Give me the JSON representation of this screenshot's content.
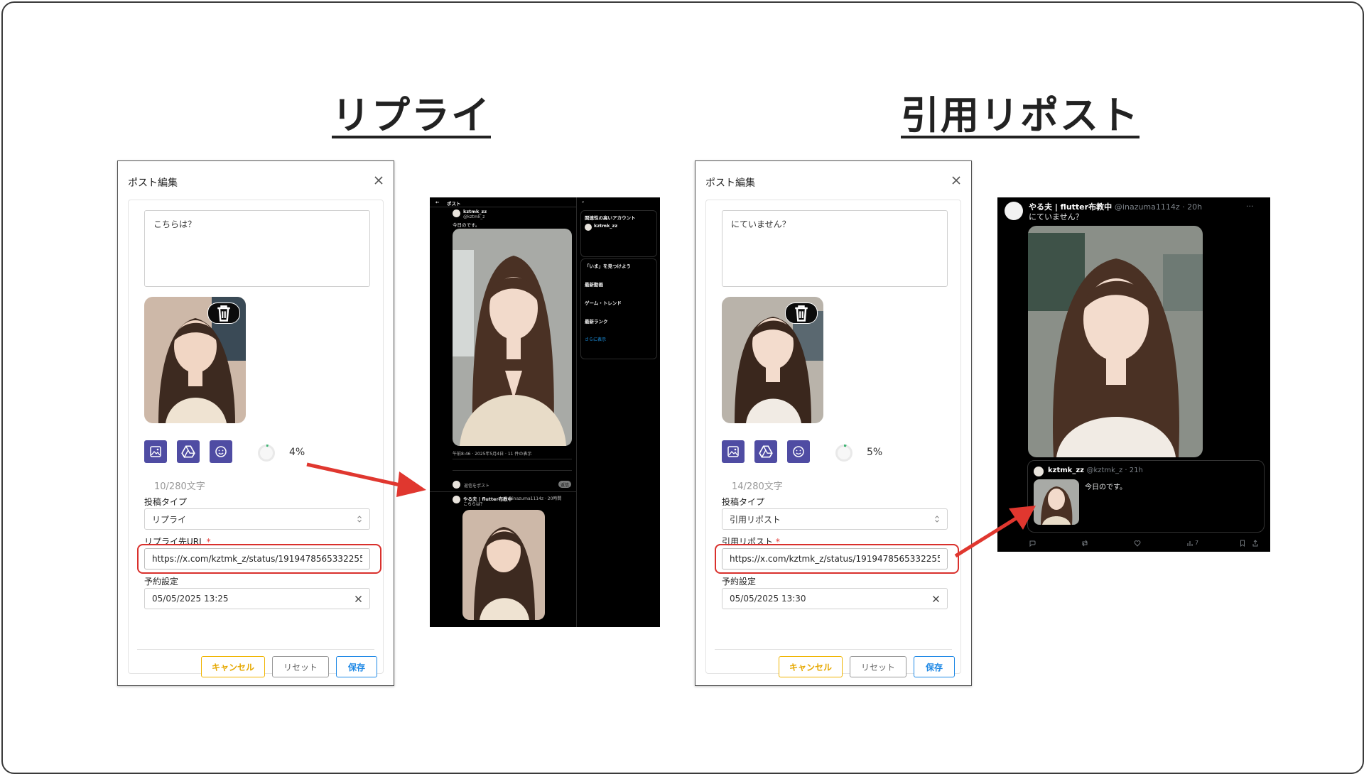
{
  "headings": {
    "reply": "リプライ",
    "quote": "引用リポスト"
  },
  "reply_dialog": {
    "title": "ポスト編集",
    "post_text": "こちらは？",
    "progress_percent": 4,
    "progress_label": "4%",
    "char_count": "10/280文字",
    "post_type_label": "投稿タイプ",
    "post_type_value": "リプライ",
    "url_label": "リプライ先URL",
    "required_mark": "*",
    "url_value": "https://x.com/kztmk_z/status/1919478565332255",
    "schedule_label": "予約設定",
    "schedule_value": "05/05/2025 13:25",
    "cancel_label": "キャンセル",
    "reset_label": "リセット",
    "save_label": "保存"
  },
  "quote_dialog": {
    "title": "ポスト編集",
    "post_text": "にていません？",
    "progress_percent": 5,
    "progress_label": "5%",
    "char_count": "14/280文字",
    "post_type_label": "投稿タイプ",
    "post_type_value": "引用リポスト",
    "url_label": "引用リポスト",
    "required_mark": "*",
    "url_value": "https://x.com/kztmk_z/status/1919478565332255",
    "schedule_label": "予約設定",
    "schedule_value": "05/05/2025 13:30",
    "cancel_label": "キャンセル",
    "reset_label": "リセット",
    "save_label": "保存"
  },
  "reply_screenshot": {
    "header_title": "ポスト",
    "user_name": "kztmk_zz",
    "user_handle": "@kztmk_z",
    "post_text": "今日のです。",
    "stats": "午前8:46 · 2025年5月4日 · 11 件の表示",
    "reply_prompt": "返信をポスト",
    "reply_btn": "返信",
    "reply_user": "やる夫 | flutter布教中",
    "reply_handle": "@inazuma1114z · 20時間",
    "reply_text": "こちらは？",
    "sidebar_title": "関連性の高いアカウント",
    "sidebar_user": "kztmk_zz",
    "trends_title": "「いま」を見つけよう",
    "trend_1": "最新動画",
    "trend_2": "ゲーム・トレンド",
    "trend_3": "最新ランク",
    "show_more": "さらに表示"
  },
  "quote_screenshot": {
    "user_name": "やる夫 | flutter布教中",
    "user_meta": "@inazuma1114z · 20h",
    "post_text": "にていません？",
    "quoted_name": "kztmk_zz",
    "quoted_meta": "@kztmk_z · 21h",
    "quoted_text": "今日のです。",
    "view_count": "7"
  },
  "colors": {
    "accent_purple": "#4f4ca3",
    "highlight_red": "#d9302c",
    "cancel_yellow": "#f0b400",
    "save_blue": "#1e88e5",
    "arrow_red": "#e0372f",
    "progress_green": "#3cb371"
  },
  "icons": [
    "close-icon",
    "trash-icon",
    "image-icon",
    "drive-icon",
    "emoji-icon",
    "chevron-updown-icon",
    "clear-icon",
    "arrow-icon"
  ]
}
